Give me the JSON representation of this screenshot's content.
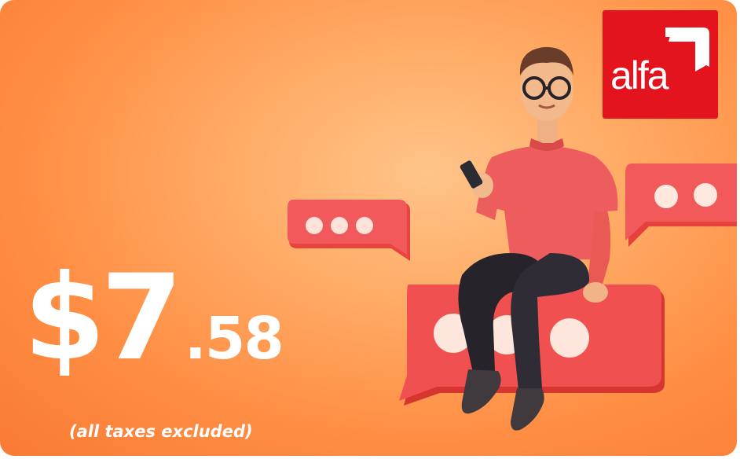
{
  "brand": {
    "logo_text": "alfa",
    "logo_color": "#e3141e"
  },
  "offer": {
    "price_main": "$7",
    "price_cents": ".58",
    "tax_note": "(all taxes excluded)"
  },
  "colors": {
    "background": "#ff9a50",
    "bubble": "#f0464a",
    "shirt": "#ee5a5a"
  }
}
